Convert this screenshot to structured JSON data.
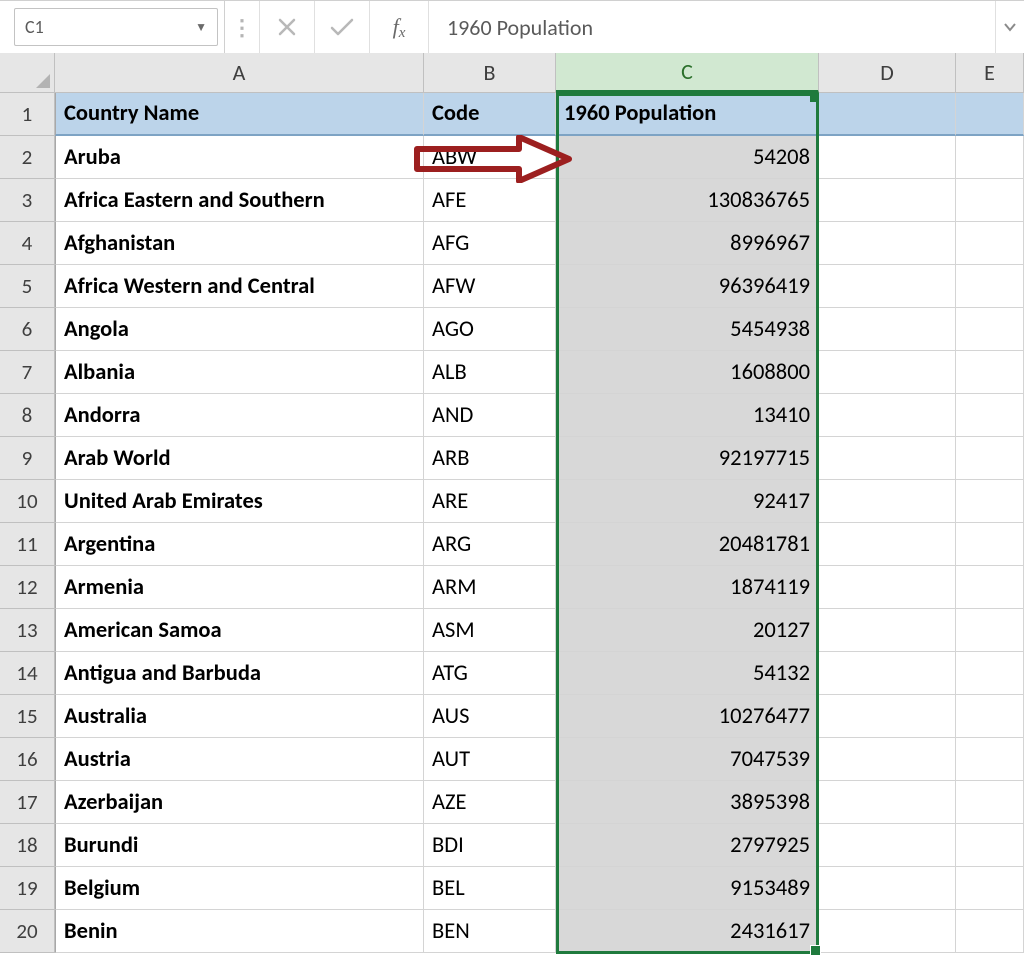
{
  "formula_bar": {
    "cell_ref": "C1",
    "formula_value": "1960 Population"
  },
  "columns": [
    "A",
    "B",
    "C",
    "D",
    "E"
  ],
  "active_column_index": 2,
  "row_count": 20,
  "headers": {
    "country": "Country Name",
    "code": "Code",
    "pop": "1960 Population"
  },
  "rows": [
    {
      "country": "Aruba",
      "code": "ABW",
      "pop": "54208"
    },
    {
      "country": "Africa Eastern and Southern",
      "code": "AFE",
      "pop": "130836765"
    },
    {
      "country": "Afghanistan",
      "code": "AFG",
      "pop": "8996967"
    },
    {
      "country": "Africa Western and Central",
      "code": "AFW",
      "pop": "96396419"
    },
    {
      "country": "Angola",
      "code": "AGO",
      "pop": "5454938"
    },
    {
      "country": "Albania",
      "code": "ALB",
      "pop": "1608800"
    },
    {
      "country": "Andorra",
      "code": "AND",
      "pop": "13410"
    },
    {
      "country": "Arab World",
      "code": "ARB",
      "pop": "92197715"
    },
    {
      "country": "United Arab Emirates",
      "code": "ARE",
      "pop": "92417"
    },
    {
      "country": "Argentina",
      "code": "ARG",
      "pop": "20481781"
    },
    {
      "country": "Armenia",
      "code": "ARM",
      "pop": "1874119"
    },
    {
      "country": "American Samoa",
      "code": "ASM",
      "pop": "20127"
    },
    {
      "country": "Antigua and Barbuda",
      "code": "ATG",
      "pop": "54132"
    },
    {
      "country": "Australia",
      "code": "AUS",
      "pop": "10276477"
    },
    {
      "country": "Austria",
      "code": "AUT",
      "pop": "7047539"
    },
    {
      "country": "Azerbaijan",
      "code": "AZE",
      "pop": "3895398"
    },
    {
      "country": "Burundi",
      "code": "BDI",
      "pop": "2797925"
    },
    {
      "country": "Belgium",
      "code": "BEL",
      "pop": "9153489"
    },
    {
      "country": "Benin",
      "code": "BEN",
      "pop": "2431617"
    }
  ]
}
